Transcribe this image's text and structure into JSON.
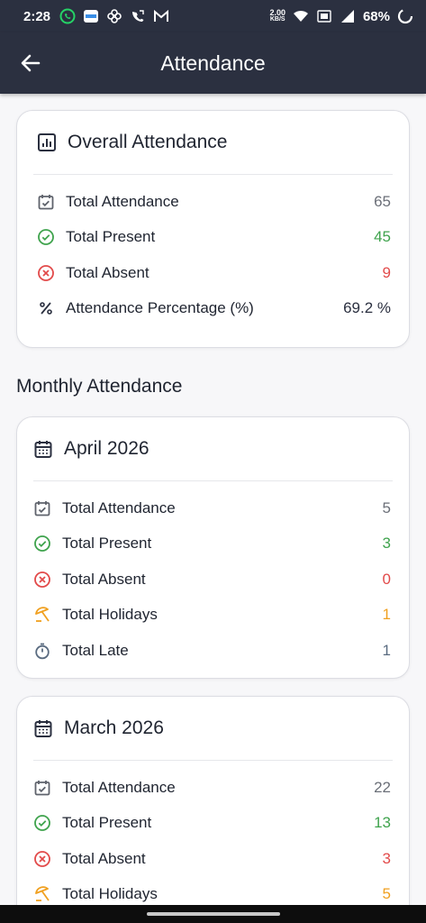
{
  "status_bar": {
    "time": "2:28",
    "net_speed_top": "2.00",
    "net_speed_bottom": "KB/S",
    "battery": "68%"
  },
  "app_bar": {
    "title": "Attendance"
  },
  "overall": {
    "title": "Overall Attendance",
    "rows": [
      {
        "label": "Total Attendance",
        "value": "65",
        "icon": "calendar-check-icon",
        "color": "#6b6f78"
      },
      {
        "label": "Total Present",
        "value": "45",
        "icon": "check-circle-icon",
        "color": "#3fa34d"
      },
      {
        "label": "Total Absent",
        "value": "9",
        "icon": "x-circle-icon",
        "color": "#e24a4a"
      },
      {
        "label": "Attendance Percentage (%)",
        "value": "69.2 %",
        "icon": "percent-icon",
        "color": "#2b3040"
      }
    ]
  },
  "monthly_section_title": "Monthly Attendance",
  "months": [
    {
      "title": "April 2026",
      "rows": [
        {
          "label": "Total Attendance",
          "value": "5"
        },
        {
          "label": "Total Present",
          "value": "3"
        },
        {
          "label": "Total Absent",
          "value": "0"
        },
        {
          "label": "Total Holidays",
          "value": "1"
        },
        {
          "label": "Total Late",
          "value": "1"
        }
      ]
    },
    {
      "title": "March 2026",
      "rows": [
        {
          "label": "Total Attendance",
          "value": "22"
        },
        {
          "label": "Total Present",
          "value": "13"
        },
        {
          "label": "Total Absent",
          "value": "3"
        },
        {
          "label": "Total Holidays",
          "value": "5"
        }
      ]
    }
  ],
  "colors": {
    "app_bar": "#2b3040",
    "present": "#3fa34d",
    "absent": "#e24a4a",
    "holiday": "#f0a020",
    "late": "#5a6b80",
    "neutral": "#6b6f78"
  }
}
